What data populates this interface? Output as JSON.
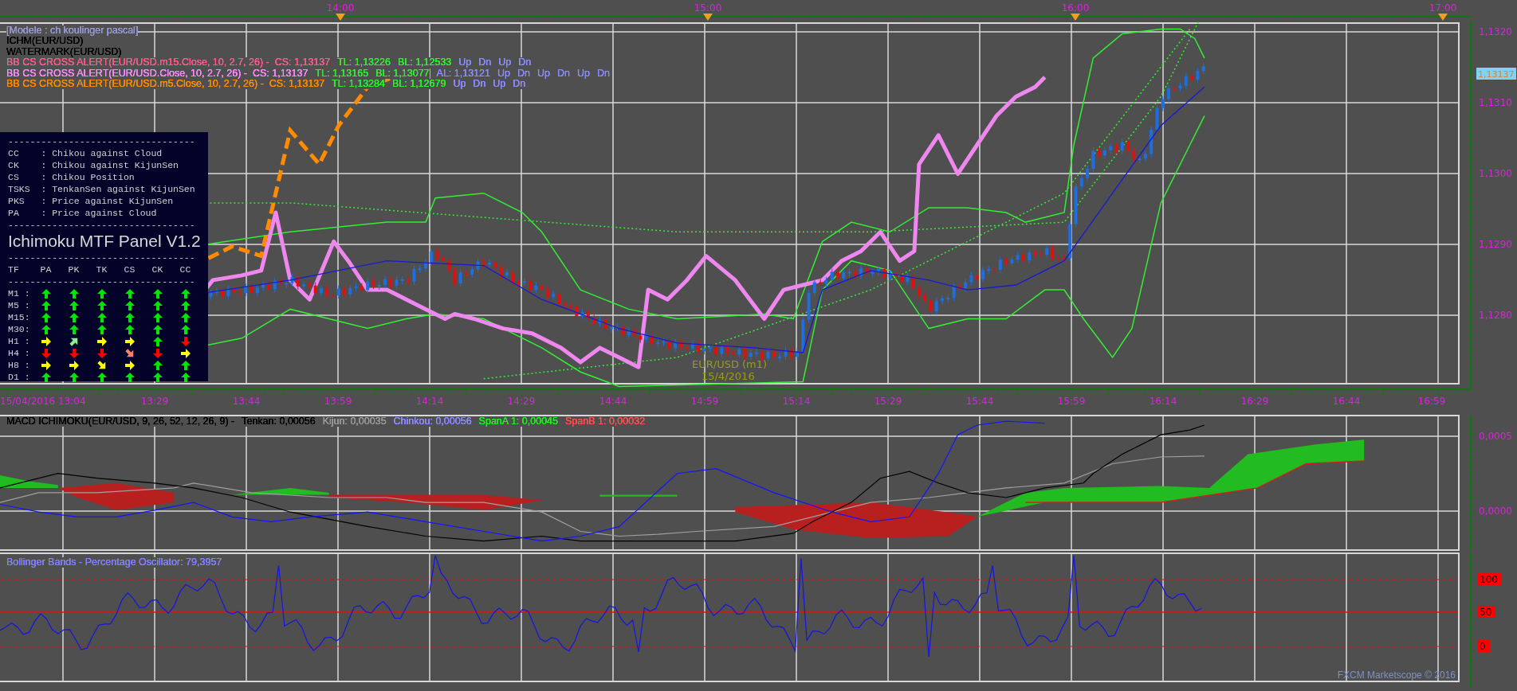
{
  "top_time_markers": [
    "14:00",
    "15:00",
    "16:00",
    "17:00"
  ],
  "main_chart": {
    "legend": [
      {
        "segments": [
          {
            "text": "[Modele : ch koulinger pascal]",
            "color": "#9898d0"
          }
        ]
      },
      {
        "segments": [
          {
            "text": "ICHM(EUR/USD)",
            "color": "#000000"
          }
        ]
      },
      {
        "segments": [
          {
            "text": "WATERMARK(EUR/USD)",
            "color": "#000000"
          }
        ]
      },
      {
        "segments": [
          {
            "text": "BB CS CROSS ALERT(EUR/USD.m15.Close, 10, 2.7, 26) -  CS: 1,13137",
            "color": "#ff5a8a"
          },
          {
            "text": "TL: 1,13226",
            "color": "#33ee33"
          },
          {
            "text": "BL: 1,12533",
            "color": "#33ee33"
          },
          {
            "text": "Up",
            "color": "#8c8cff"
          },
          {
            "text": "Dn",
            "color": "#8c8cff"
          },
          {
            "text": "Up",
            "color": "#8c8cff"
          },
          {
            "text": "Dn",
            "color": "#8c8cff"
          }
        ]
      },
      {
        "segments": [
          {
            "text": "BB CS CROSS ALERT(EUR/USD.Close, 10, 2.7, 26) -  CS: 1,13137",
            "color": "#ff88ff"
          },
          {
            "text": "TL: 1,13165",
            "color": "#33ee33"
          },
          {
            "text": "BL: 1,13077",
            "color": "#33ee33"
          },
          {
            "text": "AL: 1,13121",
            "color": "#8c8cff"
          },
          {
            "text": "Up",
            "color": "#8c8cff"
          },
          {
            "text": "Dn",
            "color": "#8c8cff"
          },
          {
            "text": "Up",
            "color": "#8c8cff"
          },
          {
            "text": "Dn",
            "color": "#8c8cff"
          },
          {
            "text": "Up",
            "color": "#8c8cff"
          },
          {
            "text": "Dn",
            "color": "#8c8cff"
          }
        ]
      },
      {
        "segments": [
          {
            "text": "BB CS CROSS ALERT(EUR/USD.m5.Close, 10, 2.7, 26) -  CS: 1,13137",
            "color": "#ff8c00"
          },
          {
            "text": "TL: 1,13284",
            "color": "#33ee33"
          },
          {
            "text": "BL: 1,12679",
            "color": "#33ee33"
          },
          {
            "text": "Up",
            "color": "#8c8cff"
          },
          {
            "text": "Dn",
            "color": "#8c8cff"
          },
          {
            "text": "Up",
            "color": "#8c8cff"
          },
          {
            "text": "Dn",
            "color": "#8c8cff"
          }
        ]
      }
    ],
    "price_labels": [
      "1,1320",
      "1,1310",
      "1,1300",
      "1,1290",
      "1,1280"
    ],
    "current_price": "1,13137",
    "watermark": [
      "EUR/USD (m1)",
      "15/4/2016"
    ]
  },
  "panel": {
    "separators": [
      "----------------------------------",
      "----------------------------------",
      "----------------------------------",
      "----------------------------------"
    ],
    "legend": [
      "CC    : Chikou against Cloud",
      "CK    : Chikou against KijunSen",
      "CS    : Chikou Position",
      "TSKS  : TenkanSen against KijunSen",
      "PKS   : Price against KijunSen",
      "PA    : Price against Cloud"
    ],
    "title": "Ichimoku MTF Panel V1.2",
    "columns": [
      "TF",
      "PA",
      "PK",
      "TK",
      "CS",
      "CK",
      "CC"
    ],
    "rows": [
      {
        "tf": "M1 :",
        "arrows": [
          {
            "kind": "up",
            "color": "#00e600"
          },
          {
            "kind": "up",
            "color": "#00e600"
          },
          {
            "kind": "up",
            "color": "#00e600"
          },
          {
            "kind": "up",
            "color": "#00e600"
          },
          {
            "kind": "up",
            "color": "#00e600"
          },
          {
            "kind": "up",
            "color": "#00e600"
          }
        ]
      },
      {
        "tf": "M5 :",
        "arrows": [
          {
            "kind": "up",
            "color": "#00e600"
          },
          {
            "kind": "up",
            "color": "#00e600"
          },
          {
            "kind": "up",
            "color": "#00e600"
          },
          {
            "kind": "up",
            "color": "#00e600"
          },
          {
            "kind": "up",
            "color": "#00e600"
          },
          {
            "kind": "up",
            "color": "#00e600"
          }
        ]
      },
      {
        "tf": "M15:",
        "arrows": [
          {
            "kind": "up",
            "color": "#00e600"
          },
          {
            "kind": "up",
            "color": "#00e600"
          },
          {
            "kind": "up",
            "color": "#00e600"
          },
          {
            "kind": "up",
            "color": "#00e600"
          },
          {
            "kind": "up",
            "color": "#00e600"
          },
          {
            "kind": "up",
            "color": "#00e600"
          }
        ]
      },
      {
        "tf": "M30:",
        "arrows": [
          {
            "kind": "up",
            "color": "#00e600"
          },
          {
            "kind": "up",
            "color": "#00e600"
          },
          {
            "kind": "up",
            "color": "#00e600"
          },
          {
            "kind": "up",
            "color": "#00e600"
          },
          {
            "kind": "up",
            "color": "#00e600"
          },
          {
            "kind": "up",
            "color": "#00e600"
          }
        ]
      },
      {
        "tf": "H1 :",
        "arrows": [
          {
            "kind": "right",
            "color": "#ffff00"
          },
          {
            "kind": "up-right",
            "color": "#90ee90"
          },
          {
            "kind": "right",
            "color": "#ffff00"
          },
          {
            "kind": "right",
            "color": "#ffff00"
          },
          {
            "kind": "up",
            "color": "#00e600"
          },
          {
            "kind": "down",
            "color": "#ff0000"
          }
        ]
      },
      {
        "tf": "H4 :",
        "arrows": [
          {
            "kind": "down",
            "color": "#ff0000"
          },
          {
            "kind": "down",
            "color": "#ff0000"
          },
          {
            "kind": "down",
            "color": "#ff0000"
          },
          {
            "kind": "down-right",
            "color": "#fa8072"
          },
          {
            "kind": "down",
            "color": "#ff0000"
          },
          {
            "kind": "right",
            "color": "#ffff00"
          }
        ]
      },
      {
        "tf": "H8 :",
        "arrows": [
          {
            "kind": "right",
            "color": "#ffff00"
          },
          {
            "kind": "right",
            "color": "#ffff00"
          },
          {
            "kind": "down-right",
            "color": "#ffff00"
          },
          {
            "kind": "right",
            "color": "#ffff00"
          },
          {
            "kind": "up",
            "color": "#00e600"
          },
          {
            "kind": "up",
            "color": "#00e600"
          }
        ]
      },
      {
        "tf": "D1 :",
        "arrows": [
          {
            "kind": "up",
            "color": "#00e600"
          },
          {
            "kind": "up",
            "color": "#00e600"
          },
          {
            "kind": "up",
            "color": "#00e600"
          },
          {
            "kind": "up",
            "color": "#00e600"
          },
          {
            "kind": "up",
            "color": "#00e600"
          },
          {
            "kind": "up",
            "color": "#00e600"
          }
        ]
      }
    ]
  },
  "time_axis": [
    "15/04/2016 13:04",
    "13:29",
    "13:44",
    "13:59",
    "14:14",
    "14:29",
    "14:44",
    "14:59",
    "15:14",
    "15:29",
    "15:44",
    "15:59",
    "16:14",
    "16:29",
    "16:44",
    "16:59"
  ],
  "macd": {
    "legend": [
      {
        "text": "MACD ICHIMOKU(EUR/USD, 9, 26, 52, 12, 26, 9) -",
        "color": "#000000"
      },
      {
        "text": "Tenkan: 0,00056",
        "color": "#000000"
      },
      {
        "text": "Kijun: 0,00035",
        "color": "#9a9a9a"
      },
      {
        "text": "Chinkou: 0,00056",
        "color": "#8c8cff"
      },
      {
        "text": "SpanA 1: 0,00045",
        "color": "#22ee22"
      },
      {
        "text": "SpanB 1: 0,00032",
        "color": "#ff5050"
      }
    ],
    "axis_labels": [
      "0,0005",
      "0,0000"
    ]
  },
  "bollinger": {
    "title": "Bollinger Bands - Percentage Oscillator: 79,3957",
    "levels": [
      "100",
      "50",
      "0"
    ]
  },
  "footer": "FXCM Marketscope © 2016"
}
